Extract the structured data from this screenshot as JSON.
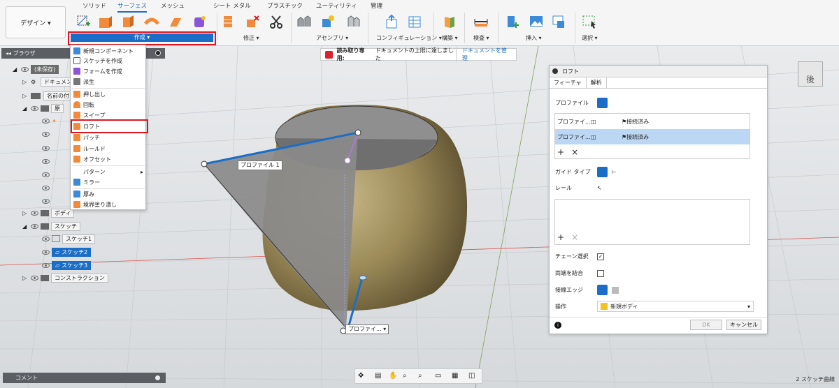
{
  "workspace": {
    "label": "デザイン ▾"
  },
  "tabs": [
    "ソリッド",
    "サーフェス",
    "メッシュ",
    "シート メタル",
    "プラスチック",
    "ユーティリティ",
    "管理"
  ],
  "groups": {
    "create": "作成 ▾",
    "modify": "修正 ▾",
    "assemble": "アセンブリ ▾",
    "configure": "コンフィギュレーション ▾",
    "construct": "構築 ▾",
    "inspect": "検査 ▾",
    "insert": "挿入 ▾",
    "select": "選択 ▾"
  },
  "browser": {
    "title": "ブラウザ",
    "root": "(未保存)",
    "doc_settings": "ドキュメントの設定",
    "named_views": "名前の付いたビュー",
    "origin": "原",
    "bodies": "ボディ",
    "sketches": "スケッチ",
    "sketch1": "スケッチ1",
    "sketch2": "スケッチ2",
    "sketch3": "スケッチ3",
    "construction": "コンストラクション"
  },
  "menu": {
    "items": [
      "新規コンポーネント",
      "スケッチを作成",
      "フォームを作成",
      "派生",
      "押し出し",
      "回転",
      "スイープ",
      "ロフト",
      "パッチ",
      "ルールド",
      "オフセット",
      "パターン",
      "ミラー",
      "厚み",
      "境界塗り潰し"
    ]
  },
  "readonly": {
    "label": "読み取り専用:",
    "message": "ドキュメントの上限に達しました",
    "manage": "ドキュメントを管理"
  },
  "canvas": {
    "profile1": "プロファイル 1",
    "profile_drop": "プロファイ... ▾"
  },
  "panel": {
    "title": "ロフト",
    "tab_feature": "フィーチャ",
    "tab_analysis": "解析",
    "profile_label": "プロファイル",
    "profiles": [
      {
        "name": "プロファイ...",
        "status": "接続済み"
      },
      {
        "name": "プロファイ...",
        "status": "接続済み"
      }
    ],
    "guide_type": "ガイド タイプ",
    "rail": "レール",
    "chain": "チェーン選択",
    "close_ends": "両端を結合",
    "tangent_edges": "接線エッジ",
    "operation_label": "操作",
    "operation_value": "新規ボディ",
    "ok": "OK",
    "cancel": "キャンセル"
  },
  "comment": "コメント",
  "status": "2 スケッチ曲線",
  "viewcube": "後"
}
